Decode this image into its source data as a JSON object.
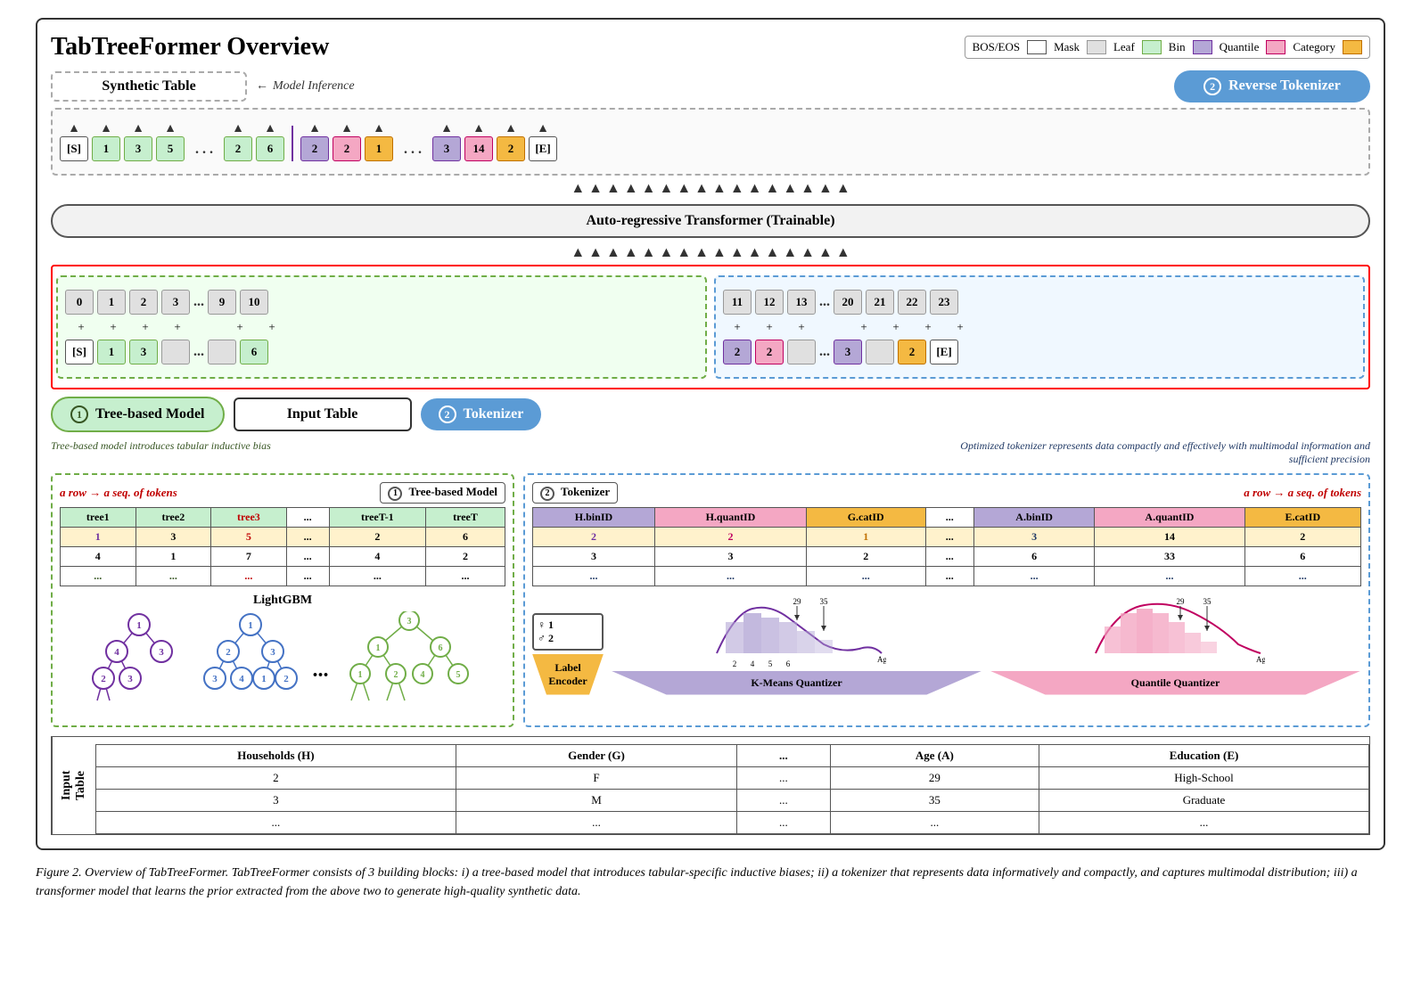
{
  "title": "TabTreeFormer Overview",
  "legend": {
    "items": [
      {
        "label": "BOS/EOS",
        "color": "#ffffff",
        "border": "#555"
      },
      {
        "label": "Mask",
        "color": "#e0e0e0",
        "border": "#999"
      },
      {
        "label": "Leaf",
        "color": "#c6efce",
        "border": "#70ad47"
      },
      {
        "label": "Bin",
        "color": "#b4a7d6",
        "border": "#7030a0"
      },
      {
        "label": "Quantile",
        "color": "#f4a7c3",
        "border": "#c00060"
      },
      {
        "label": "Category",
        "color": "#f4b942",
        "border": "#c07000"
      }
    ]
  },
  "synthetic_table": "Synthetic Table",
  "model_inference": "Model Inference",
  "reverse_tokenizer": "Reverse Tokenizer",
  "transformer": "Auto-regressive Transformer (Trainable)",
  "tree_model": "Tree-based Model",
  "tokenizer": "Tokenizer",
  "input_table_label": "Input Table",
  "tree_model_note": "Tree-based model introduces tabular inductive bias",
  "tokenizer_note": "Optimized tokenizer represents data compactly and effectively with multimodal information and sufficient precision",
  "row_seq_label": "a row → a seq. of tokens",
  "lightgbm_label": "LightGBM",
  "label_encoder": "Label Encoder",
  "kmeans_quantizer": "K-Means Quantizer",
  "quantile_quantizer": "Quantile Quantizer",
  "tree_columns": [
    "tree1",
    "tree2",
    "tree3",
    "...",
    "treeT-1",
    "treeT"
  ],
  "tree_row1": [
    "1",
    "3",
    "5",
    "...",
    "2",
    "6"
  ],
  "tree_row2": [
    "4",
    "1",
    "7",
    "...",
    "4",
    "2"
  ],
  "tree_row3": [
    "...",
    "...",
    "...",
    "...",
    "...",
    "..."
  ],
  "tok_columns": [
    "H.binID",
    "H.quantID",
    "G.catID",
    "...",
    "A.binID",
    "A.quantID",
    "E.catID"
  ],
  "tok_row1": [
    "2",
    "2",
    "1",
    "...",
    "3",
    "14",
    "2"
  ],
  "tok_row2": [
    "3",
    "3",
    "2",
    "...",
    "6",
    "33",
    "6"
  ],
  "tok_row3": [
    "...",
    "...",
    "...",
    "...",
    "...",
    "...",
    "..."
  ],
  "pos_tokens_green": [
    "0",
    "1",
    "2",
    "3",
    "9",
    "10",
    "11",
    "12",
    "13",
    "20",
    "21",
    "22",
    "23"
  ],
  "pos_plus": [
    "+",
    "+",
    "+",
    "+",
    "+",
    "+",
    "+",
    "+",
    "+",
    "+",
    "+",
    "+",
    "+"
  ],
  "bottom_tokens_green": [
    "[S]",
    "1",
    "3",
    "",
    "",
    "6",
    "2",
    "2",
    "",
    "",
    "3",
    "",
    "2",
    "[E]"
  ],
  "input_table": {
    "headers": [
      "Households (H)",
      "Gender (G)",
      "...",
      "Age (A)",
      "Education (E)"
    ],
    "rows": [
      [
        "2",
        "F",
        "...",
        "29",
        "High-School"
      ],
      [
        "3",
        "M",
        "...",
        "35",
        "Graduate"
      ],
      [
        "...",
        "...",
        "...",
        "...",
        "..."
      ]
    ]
  },
  "caption": "Figure 2. Overview of TabTreeFormer. TabTreeFormer consists of 3 building blocks: i) a tree-based model that introduces tabular-specific inductive biases; ii) a tokenizer that represents data informatively and compactly, and captures multimodal distribution; iii) a transformer model that learns the prior extracted from the above two to generate high-quality synthetic data."
}
